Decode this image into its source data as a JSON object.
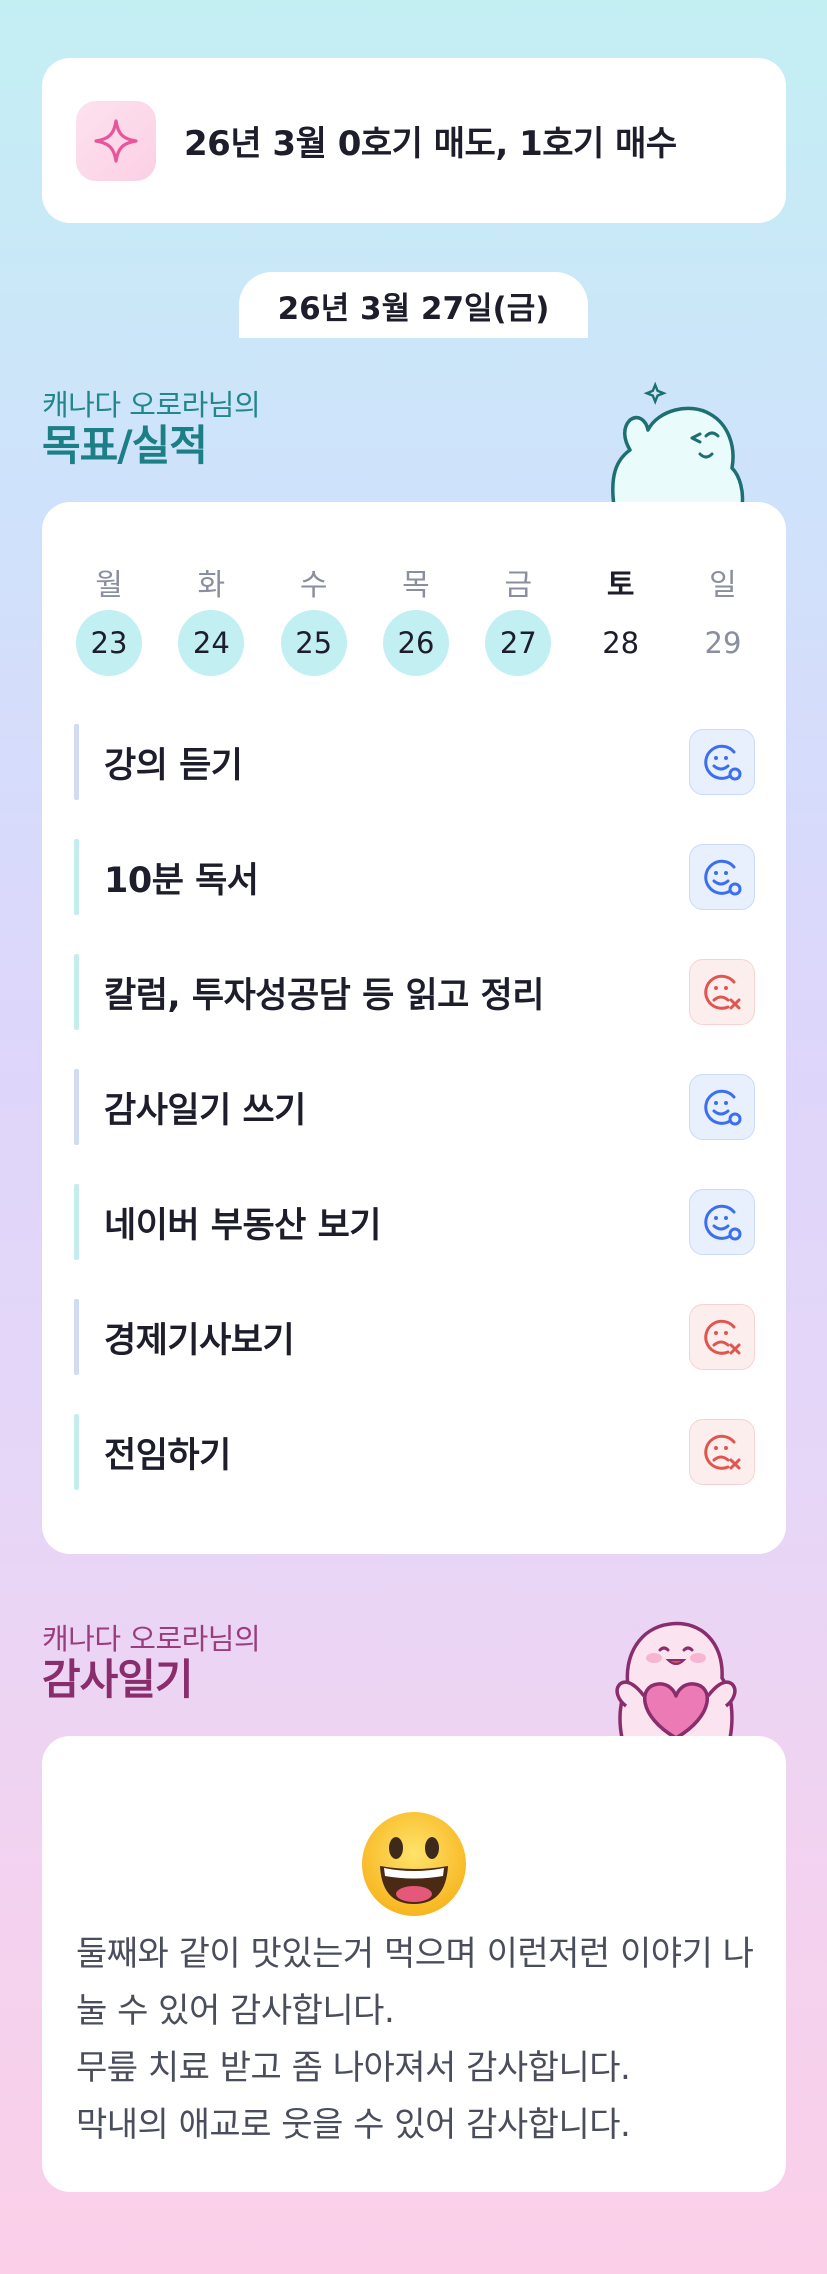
{
  "goal": {
    "icon": "sparkle-icon",
    "text": "26년 3월 0호기 매도, 1호기 매수"
  },
  "date": "26년 3월 27일(금)",
  "goals_section": {
    "subtitle": "캐나다 오로라님의",
    "title": "목표/실적"
  },
  "calendar": {
    "weekdays": [
      "월",
      "화",
      "수",
      "목",
      "금",
      "토",
      "일"
    ],
    "dates": [
      "23",
      "24",
      "25",
      "26",
      "27",
      "28",
      "29"
    ]
  },
  "tasks": [
    {
      "label": "강의 듣기",
      "status": "done"
    },
    {
      "label": "10분 독서",
      "status": "done"
    },
    {
      "label": "칼럼, 투자성공담 등 읽고 정리",
      "status": "missed"
    },
    {
      "label": "감사일기 쓰기",
      "status": "done"
    },
    {
      "label": "네이버 부동산 보기",
      "status": "done"
    },
    {
      "label": "경제기사보기",
      "status": "missed"
    },
    {
      "label": "전임하기",
      "status": "missed"
    }
  ],
  "diary_section": {
    "subtitle": "캐나다 오로라님의",
    "title": "감사일기"
  },
  "diary": {
    "emoji": "grinning-face-icon",
    "text": "둘째와 같이 맛있는거 먹으며 이런저런 이야기 나눌 수 있어 감사합니다.\n무릎 치료 받고 좀 나아져서 감사합니다.\n막내의 애교로 웃을 수 있어 감사합니다."
  },
  "colors": {
    "accent_teal": "#1d7f86",
    "accent_pink": "#8a2d6c",
    "done_blue": "#3b6ff0",
    "missed_red": "#e2554f"
  }
}
